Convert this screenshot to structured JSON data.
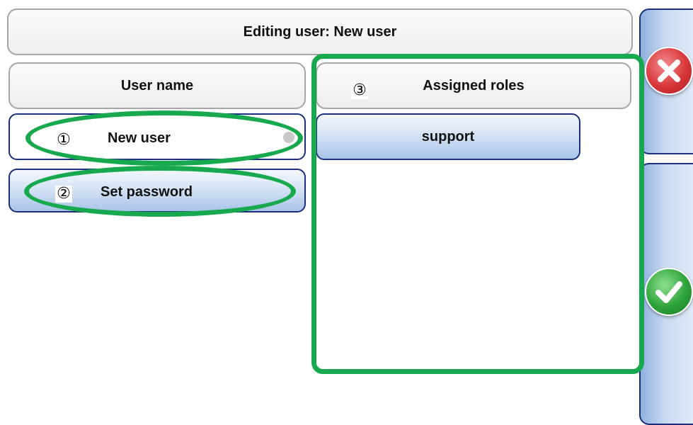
{
  "header": {
    "title": "Editing user: New user"
  },
  "user_name": {
    "label": "User name",
    "value": "New user"
  },
  "password": {
    "label": "Set password"
  },
  "roles": {
    "label": "Assigned roles",
    "items": [
      "support"
    ]
  },
  "callouts": {
    "one": "①",
    "two": "②",
    "three": "③"
  },
  "actions": {
    "cancel_icon": "close-icon",
    "confirm_icon": "checkmark-icon"
  },
  "colors": {
    "highlight": "#18a94f",
    "border_navy": "#1c2e7c",
    "cancel_red": "#d9373b",
    "confirm_green": "#2ea33b"
  }
}
